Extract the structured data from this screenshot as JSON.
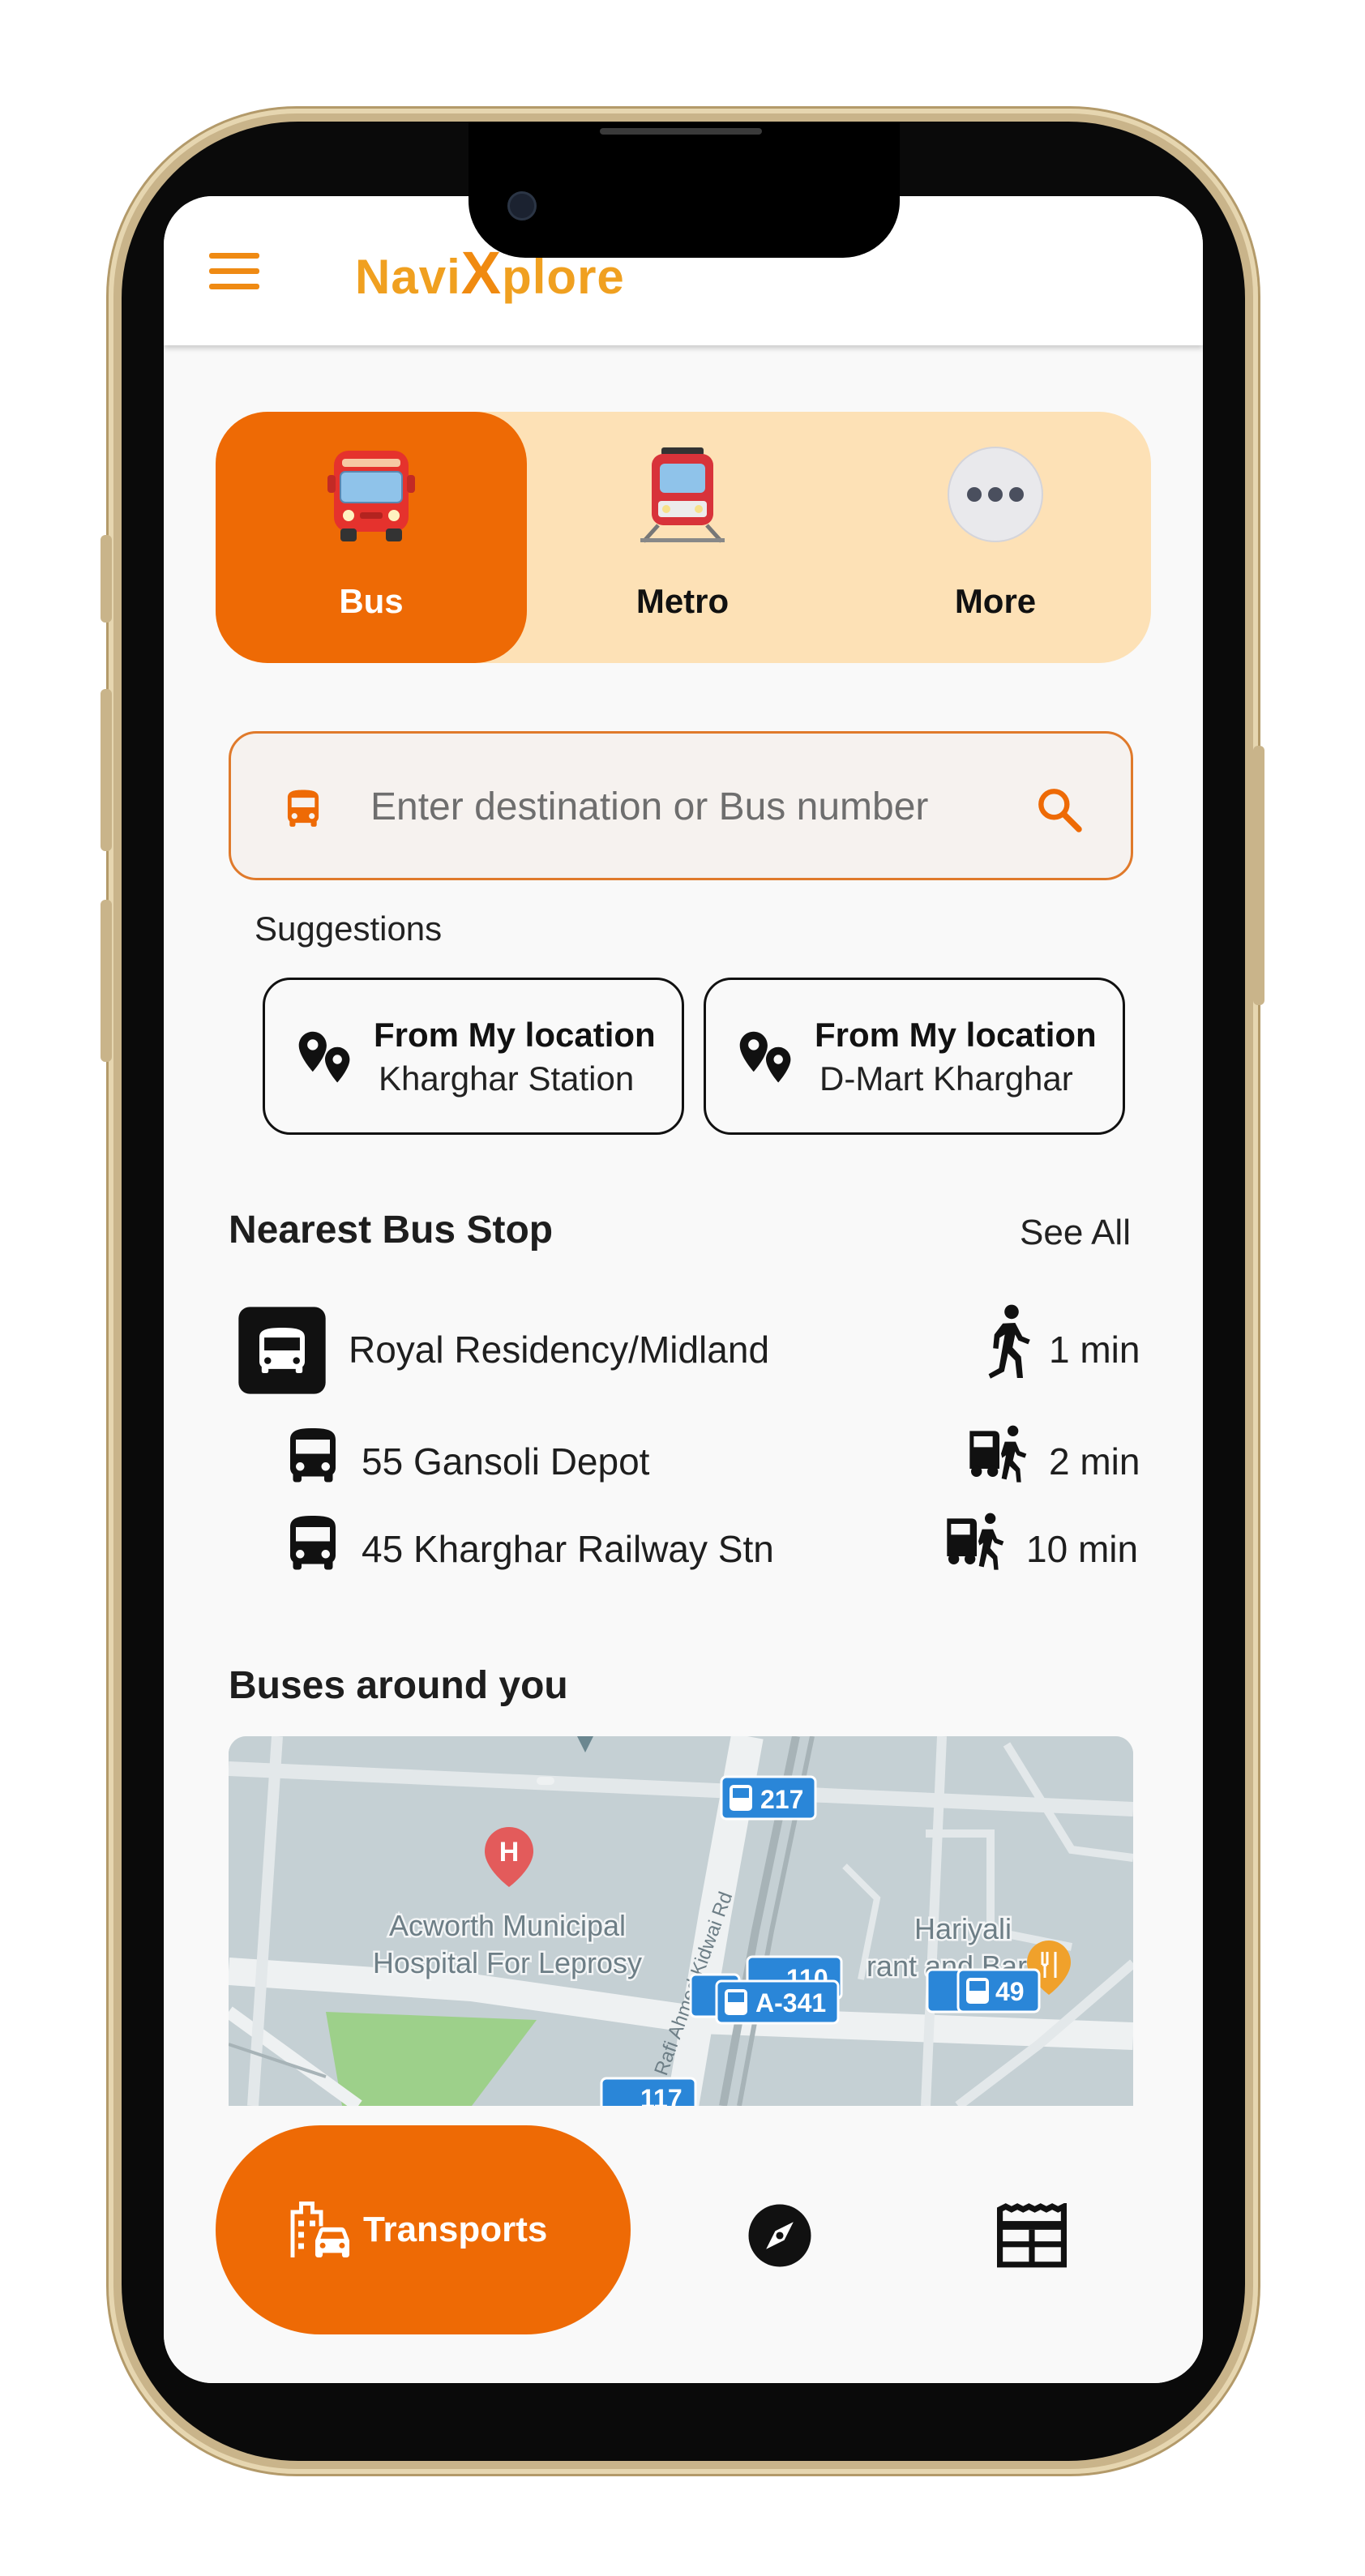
{
  "app": {
    "name_prefix": "Navi",
    "name_x": "X",
    "name_suffix": "plore"
  },
  "modes": [
    {
      "label": "Bus",
      "icon": "bus-icon",
      "active": true
    },
    {
      "label": "Metro",
      "icon": "metro-train-icon",
      "active": false
    },
    {
      "label": "More",
      "icon": "more-dots-icon",
      "active": false
    }
  ],
  "search": {
    "placeholder": "Enter destination or Bus number"
  },
  "suggestions": {
    "title": "Suggestions",
    "items": [
      {
        "line1": "From My location",
        "line2": "Kharghar Station"
      },
      {
        "line1": "From My location",
        "line2": "D-Mart Kharghar"
      }
    ]
  },
  "nearest": {
    "title": "Nearest Bus Stop",
    "see_all": "See All",
    "stop": {
      "name": "Royal Residency/Midland",
      "time": "1 min"
    },
    "routes": [
      {
        "name": "55 Gansoli Depot",
        "time": "2 min"
      },
      {
        "name": "45 Kharghar Railway Stn",
        "time": "10 min"
      }
    ]
  },
  "buses_around": {
    "title": "Buses around you",
    "map_labels": {
      "hospital": "Acworth Municipal",
      "hospital2": "Hospital For Leprosy",
      "road": "Rafi Ahmed Kidwai Rd",
      "place": "Hariyali",
      "place2": "rant and Bar"
    },
    "bus_markers": [
      "217",
      "110",
      "A-341",
      "49",
      "117"
    ]
  },
  "bottom_nav": {
    "active_label": "Transports",
    "items": [
      "transports-icon",
      "compass-icon",
      "newspaper-icon"
    ]
  },
  "colors": {
    "accent": "#ee6a05",
    "accent_light": "#fde1b6",
    "logo": "#f0a020",
    "map_bus": "#2a86d8"
  }
}
